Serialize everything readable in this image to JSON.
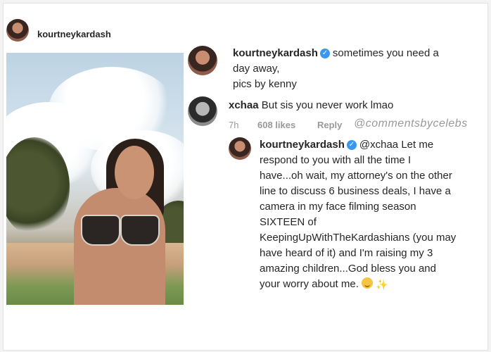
{
  "post": {
    "username": "kourtneykardash"
  },
  "caption": {
    "username": "kourtneykardash",
    "line1": "sometimes you need a",
    "line2": "day away,",
    "line3": "pics by kenny"
  },
  "comment": {
    "username": "xchaa",
    "text": "But sis you never work lmao",
    "time": "7h",
    "likes": "608 likes",
    "reply": "Reply",
    "watermark": "@commentsbycelebs"
  },
  "reply": {
    "username": "kourtneykardash",
    "mention": "@xchaa",
    "lines": [
      "Let me",
      "respond to you with all the time I",
      "have...oh wait, my attorney's on the other",
      "line to discuss 6 business deals, I have a",
      "camera in my face filming season",
      "SIXTEEN of",
      "KeepingUpWithTheKardashians (you may",
      "have heard of it) and I'm raising my 3",
      "amazing children...God bless you and",
      "your worry about me."
    ]
  },
  "icons": {
    "verified": "verified-badge-icon",
    "smile": "smiling-emoji-icon",
    "sparkles": "sparkles-emoji-icon"
  },
  "colors": {
    "verified": "#3897f0",
    "meta": "#999999",
    "text": "#262626"
  }
}
